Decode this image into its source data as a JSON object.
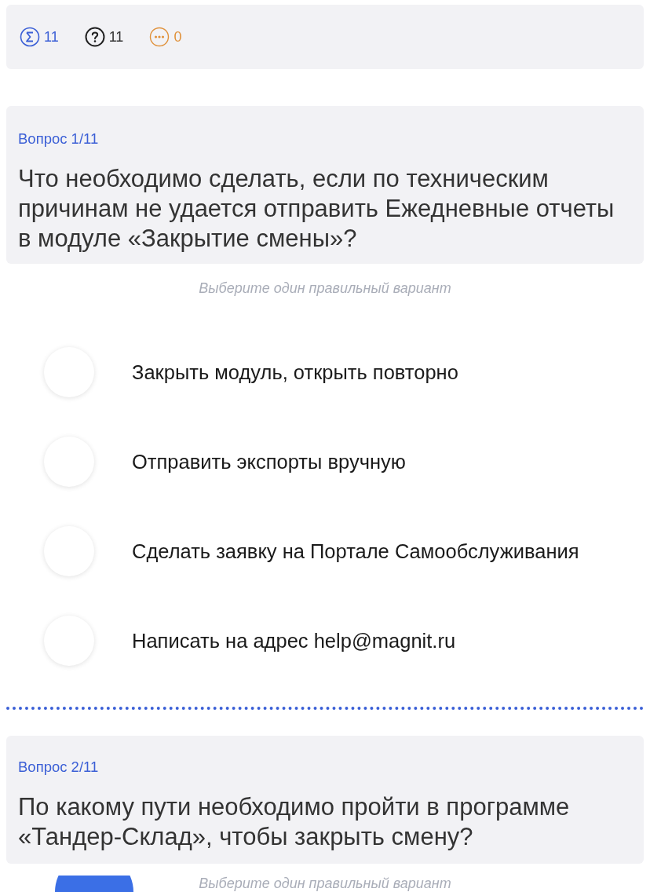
{
  "stats": [
    {
      "kind": "total",
      "count": "11"
    },
    {
      "kind": "unanswered",
      "count": "11"
    },
    {
      "kind": "pending",
      "count": "0"
    }
  ],
  "questions": [
    {
      "label": "Вопрос 1/11",
      "text": "Что необходимо сделать, если по техническим причинам не удается отправить Ежедневные отчеты в модуле «Закрытие смены»?",
      "hint": "Выберите один правильный вариант",
      "options": [
        {
          "text": "Закрыть модуль, открыть повторно",
          "selected": false
        },
        {
          "text": "Отправить экспорты вручную",
          "selected": false
        },
        {
          "text": "Сделать заявку на Портале Самообслуживания",
          "selected": false
        },
        {
          "text": "Написать на адрес help@magnit.ru",
          "selected": false
        }
      ]
    },
    {
      "label": "Вопрос 2/11",
      "text": "По какому пути необходимо пройти в программе «Тандер-Склад», чтобы закрыть смену?",
      "hint": "Выберите один правильный вариант"
    }
  ]
}
